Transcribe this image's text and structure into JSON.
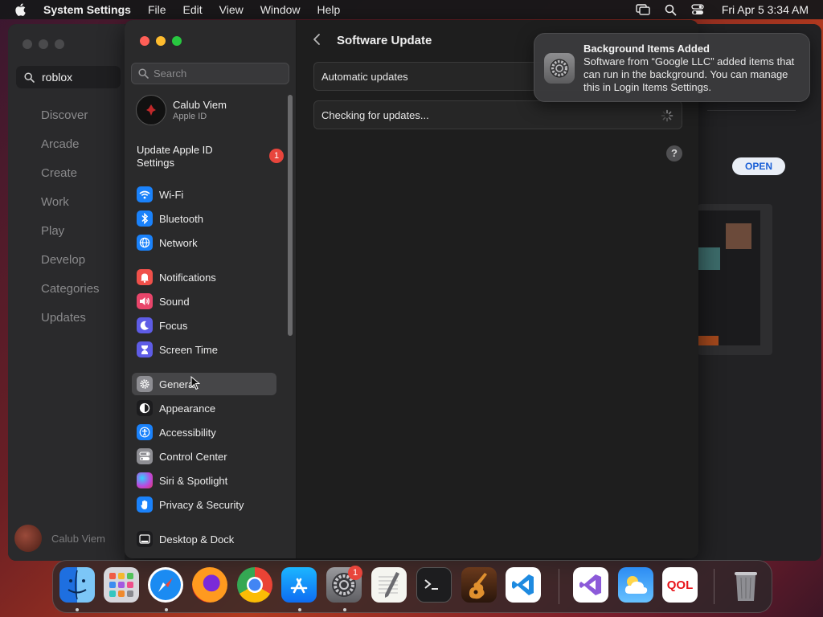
{
  "menubar": {
    "app_name": "System Settings",
    "items": [
      "File",
      "Edit",
      "View",
      "Window",
      "Help"
    ],
    "clock": "Fri Apr 5  3:34 AM"
  },
  "appstore": {
    "search_value": "roblox",
    "nav": [
      "Discover",
      "Arcade",
      "Create",
      "Work",
      "Play",
      "Develop",
      "Categories",
      "Updates"
    ],
    "user": "Calub Viem",
    "open_label": "OPEN"
  },
  "settings": {
    "search_placeholder": "Search",
    "account": {
      "name": "Calub Viem",
      "sub": "Apple ID"
    },
    "update_apple_id": "Update Apple ID Settings",
    "update_badge": "1",
    "nav": [
      {
        "label": "Wi-Fi",
        "icon": "wifi-icon",
        "color": "#1a82fb"
      },
      {
        "label": "Bluetooth",
        "icon": "bluetooth-icon",
        "color": "#1a82fb"
      },
      {
        "label": "Network",
        "icon": "globe-icon",
        "color": "#1a82fb"
      },
      {
        "label": "Notifications",
        "icon": "bell-icon",
        "color": "#f0504a"
      },
      {
        "label": "Sound",
        "icon": "speaker-icon",
        "color": "#e8456a"
      },
      {
        "label": "Focus",
        "icon": "moon-icon",
        "color": "#5e5ce6"
      },
      {
        "label": "Screen Time",
        "icon": "hourglass-icon",
        "color": "#5e5ce6"
      },
      {
        "label": "General",
        "icon": "gear-icon",
        "color": "#8e8e93"
      },
      {
        "label": "Appearance",
        "icon": "appearance-icon",
        "color": "#1c1c1e"
      },
      {
        "label": "Accessibility",
        "icon": "accessibility-icon",
        "color": "#1a82fb"
      },
      {
        "label": "Control Center",
        "icon": "control-center-icon",
        "color": "#8e8e93"
      },
      {
        "label": "Siri & Spotlight",
        "icon": "siri-icon",
        "color": "#b84be0"
      },
      {
        "label": "Privacy & Security",
        "icon": "hand-icon",
        "color": "#1a82fb"
      },
      {
        "label": "Desktop & Dock",
        "icon": "dock-icon",
        "color": "#1c1c1e"
      }
    ],
    "main": {
      "title": "Software Update",
      "automatic_updates": "Automatic updates",
      "checking": "Checking for updates...",
      "help": "?"
    }
  },
  "notification": {
    "title": "Background Items Added",
    "body": "Software from “Google LLC” added items that can run in the background. You can manage this in Login Items Settings."
  },
  "dock": {
    "settings_badge": "1",
    "qol_label": "QOL",
    "apps": [
      "finder-icon",
      "launchpad-icon",
      "safari-icon",
      "firefox-icon",
      "chrome-icon",
      "app-store-icon",
      "system-settings-icon",
      "textedit-icon",
      "terminal-icon",
      "garageband-icon",
      "vscode-icon",
      "visual-studio-icon",
      "weather-icon",
      "qol-icon",
      "trash-icon"
    ]
  }
}
